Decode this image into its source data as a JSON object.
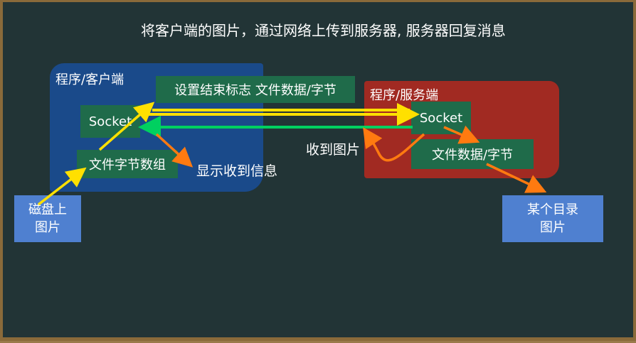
{
  "title": "将客户端的图片，通过网络上传到服务器, 服务器回复消息",
  "client": {
    "label": "程序/客户端",
    "socket": "Socket",
    "byte_array": "文件字节数组",
    "flag_box": "设置结束标志 文件数据/字节"
  },
  "server": {
    "label": "程序/服务端",
    "socket": "Socket",
    "file_data": "文件数据/字节"
  },
  "disk": {
    "line1": "磁盘上",
    "line2": "图片"
  },
  "directory": {
    "line1": "某个目录",
    "line2": "图片"
  },
  "annotations": {
    "show_received": "显示收到信息",
    "received_image": "收到图片"
  },
  "colors": {
    "yellow_arrow": "#ffe000",
    "green_arrow": "#00d060",
    "orange_arrow": "#ff7a10",
    "client_region": "#1a4a8a",
    "server_region": "#a12a22"
  }
}
